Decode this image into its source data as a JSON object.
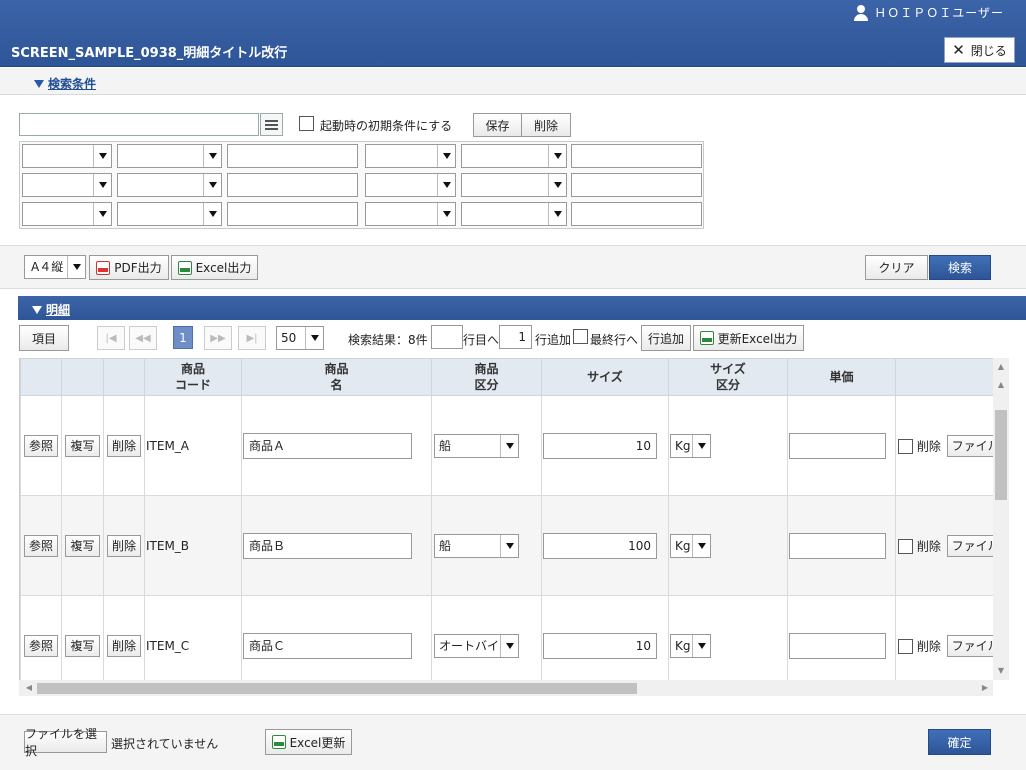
{
  "header": {
    "user_name": "ＨＯＩＰＯＩユーザー",
    "title": "SCREEN_SAMPLE_0938_明細タイトル改行",
    "close_label": "閉じる"
  },
  "search": {
    "section_label": "検索条件",
    "init_condition_label": "起動時の初期条件にする",
    "save_label": "保存",
    "delete_label": "削除"
  },
  "toolbar": {
    "paper_size": "A４縦",
    "pdf_label": "PDF出力",
    "excel_label": "Excel出力",
    "clear_label": "クリア",
    "search_label": "検索"
  },
  "detail": {
    "section_label": "明細",
    "items_label": "項目",
    "current_page": "1",
    "page_size": "50",
    "result_label": "検索結果：8件",
    "goto_suffix": "行目へ",
    "add_count": "1",
    "add_row_suffix": "行追加",
    "last_row_label": "最終行へ",
    "add_row_button": "行追加",
    "update_excel_button": "更新Excel出力"
  },
  "table": {
    "headers": [
      {
        "line1": "商品",
        "line2": "コード"
      },
      {
        "line1": "商品",
        "line2": "名"
      },
      {
        "line1": "商品",
        "line2": "区分"
      },
      {
        "line1": "サイズ",
        "line2": ""
      },
      {
        "line1": "サイズ",
        "line2": "区分"
      },
      {
        "line1": "単価",
        "line2": ""
      }
    ],
    "row_buttons": {
      "ref": "参照",
      "copy": "複写",
      "delete": "削除"
    },
    "delete_check_label": "削除",
    "file_button_label": "ファイルを",
    "rows": [
      {
        "code": "ITEM_A",
        "name": "商品Ａ",
        "category": "船",
        "size": "10",
        "size_unit": "Kg",
        "price": ""
      },
      {
        "code": "ITEM_B",
        "name": "商品Ｂ",
        "category": "船",
        "size": "100",
        "size_unit": "Kg",
        "price": ""
      },
      {
        "code": "ITEM_C",
        "name": "商品Ｃ",
        "category": "オートバイ",
        "size": "10",
        "size_unit": "Kg",
        "price": ""
      }
    ]
  },
  "footer": {
    "choose_file_label": "ファイルを選択",
    "no_file_label": "選択されていません",
    "excel_update_label": "Excel更新",
    "confirm_label": "確定"
  }
}
